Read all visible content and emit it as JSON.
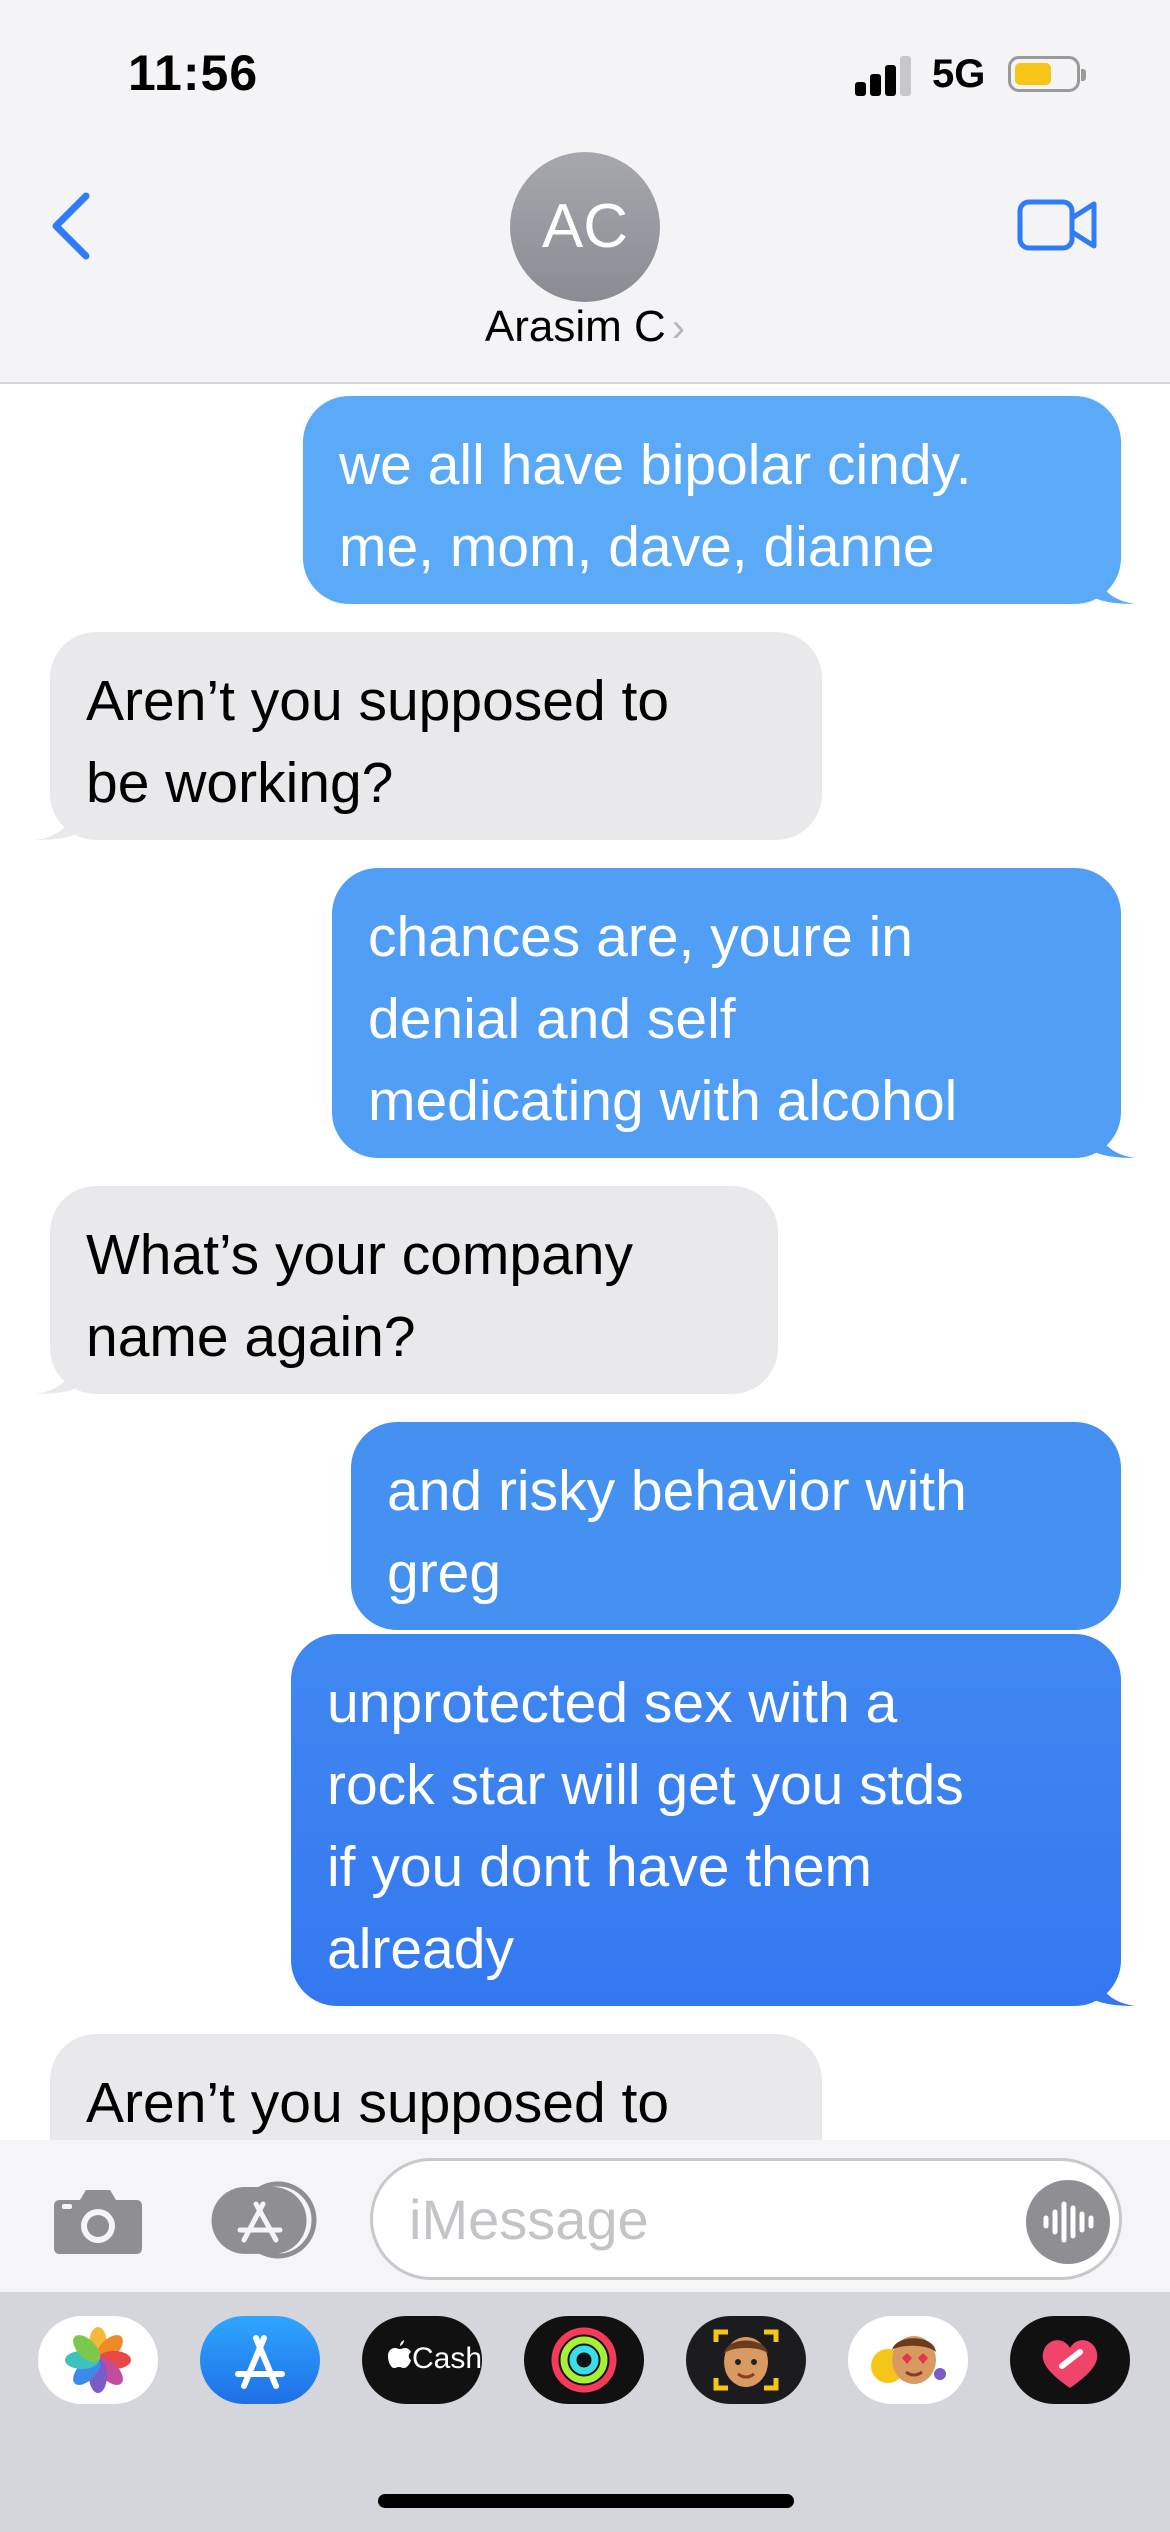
{
  "status_bar": {
    "time": "11:56",
    "network": "5G",
    "battery_level": 0.6,
    "battery_color": "#f5c518"
  },
  "header": {
    "back_icon": "chevron-left-icon",
    "avatar_initials": "AC",
    "contact_name": "Arasim C",
    "contact_chevron": "›",
    "video_icon": "video-camera-icon",
    "accent_color": "#2f7cf6"
  },
  "messages": [
    {
      "direction": "sent",
      "text": "we all have bipolar cindy.\nme, mom, dave, dianne"
    },
    {
      "direction": "received",
      "text": "Aren’t you supposed to\nbe working?"
    },
    {
      "direction": "sent",
      "text": "chances are, youre in\ndenial and self\nmedicating with alcohol"
    },
    {
      "direction": "received",
      "text": "What’s your company\nname again?"
    },
    {
      "direction": "sent",
      "text": "and risky behavior with\ngreg"
    },
    {
      "direction": "sent",
      "text": "unprotected sex with a\nrock star will get you stds\nif you dont have them\nalready"
    },
    {
      "direction": "received",
      "text": "Aren’t you supposed to"
    }
  ],
  "composer": {
    "camera_icon": "camera-icon",
    "apps_icon": "app-store-icon",
    "placeholder": "iMessage",
    "audio_icon": "waveform-icon"
  },
  "app_drawer": [
    {
      "name": "photos-app-icon"
    },
    {
      "name": "app-store-app-icon"
    },
    {
      "name": "apple-cash-app-icon",
      "label": "Cash"
    },
    {
      "name": "activity-app-icon"
    },
    {
      "name": "memoji-app-icon"
    },
    {
      "name": "memoji-stickers-app-icon"
    },
    {
      "name": "digital-touch-app-icon"
    }
  ]
}
